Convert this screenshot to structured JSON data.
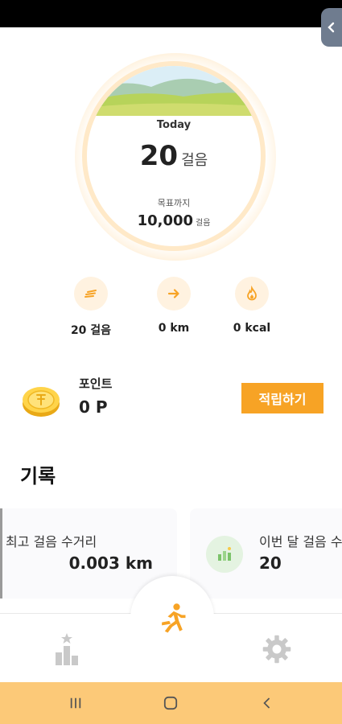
{
  "today": {
    "label": "Today",
    "steps": "20",
    "steps_unit": "걸음",
    "goal_label": "목표까지",
    "goal_steps": "10,000",
    "goal_unit": "걸음"
  },
  "stats": [
    {
      "icon": "steps-icon",
      "value": "20 걸음"
    },
    {
      "icon": "distance-arrow-icon",
      "value": "0 km"
    },
    {
      "icon": "calorie-flame-icon",
      "value": "0 kcal"
    }
  ],
  "points": {
    "title": "포인트",
    "value": "0 P",
    "earn_button": "적립하기"
  },
  "records": {
    "title": "기록",
    "cards": [
      {
        "label": "최고 걸음 수거리",
        "value": "0.003 km"
      },
      {
        "label": "이번 달 걸음 수",
        "value": "20"
      }
    ]
  },
  "nav": {
    "items": [
      "ranking-icon",
      "running-icon",
      "settings-icon"
    ]
  },
  "colors": {
    "accent": "#f7a325",
    "system_bar": "#fcc978",
    "ring_glow": "#ffe7c2"
  }
}
